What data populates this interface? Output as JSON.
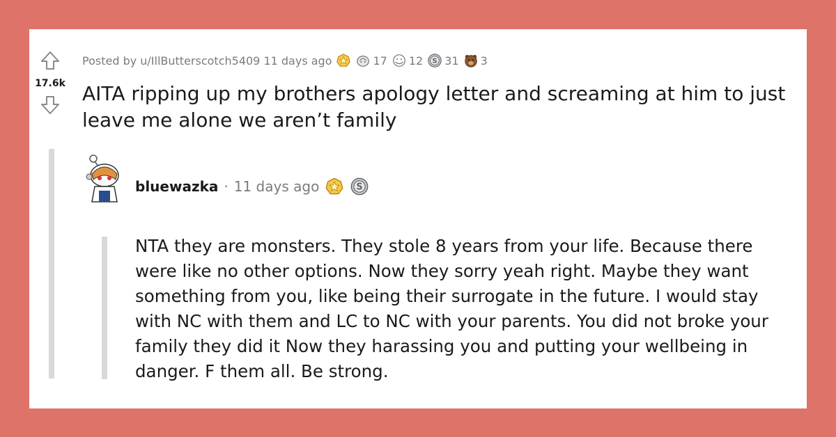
{
  "post": {
    "score": "17.6k",
    "posted_by": "Posted by u/IllButterscotch5409 11 days ago",
    "title": "AITA ripping up my brothers apology letter and screaming at him to just leave me alone we aren’t family",
    "awards": [
      {
        "icon": "gold-award-icon",
        "count": ""
      },
      {
        "icon": "wholesome-award-icon",
        "count": "17"
      },
      {
        "icon": "hugz-award-icon",
        "count": "12"
      },
      {
        "icon": "silver-award-icon",
        "count": "31"
      },
      {
        "icon": "bear-award-icon",
        "count": "3"
      }
    ]
  },
  "comment": {
    "username": "bluewazka",
    "separator": "·",
    "time": "11 days ago",
    "awards": [
      "gold-award-icon",
      "silver-award-icon"
    ],
    "body": "NTA they are monsters. They stole 8 years from your life. Because there were like no other options. Now they sorry yeah right. Maybe they want something from you, like being their surrogate in the future. I would stay with NC with them and LC to NC with your parents. You did not broke your family they did it Now they harassing you and putting your wellbeing in danger. F them all. Be strong."
  },
  "colors": {
    "background": "#dd7369",
    "card": "#ffffff",
    "text": "#1a1a1b",
    "meta": "#787c7e",
    "thread_line": "#d9d9d9"
  }
}
